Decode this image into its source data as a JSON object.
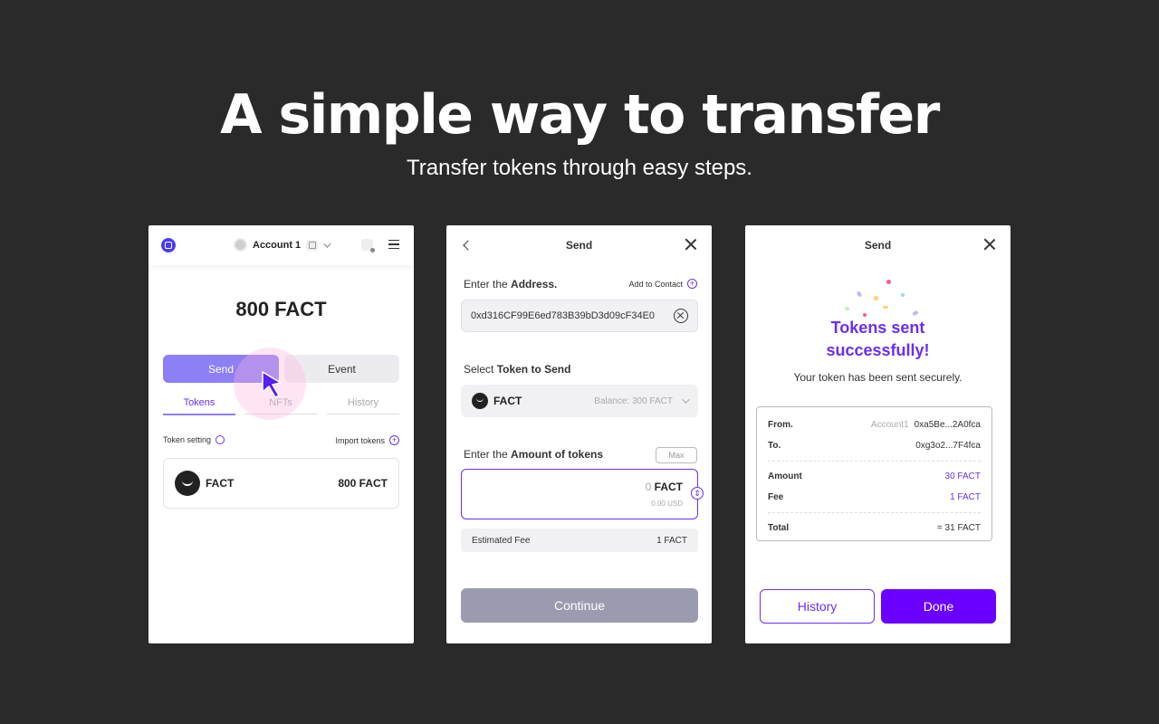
{
  "hero": {
    "title": "A simple way to transfer",
    "subtitle": "Transfer tokens through easy steps."
  },
  "wallet": {
    "account_name": "Account 1",
    "balance": "800 FACT",
    "send_label": "Send",
    "event_label": "Event",
    "tabs": [
      "Tokens",
      "NFTs",
      "History"
    ],
    "token_setting": "Token setting",
    "import_tokens": "Import tokens",
    "token_name": "FACT",
    "token_amount": "800 FACT"
  },
  "send_form": {
    "title": "Send",
    "address_label_pre": "Enter the ",
    "address_label_bold": "Address.",
    "add_contact": "Add to Contact",
    "address_value": "0xd316CF99E6ed783B39bD3d09cF34E0",
    "token_label_pre": "Select ",
    "token_label_bold": "Token to Send",
    "token_name": "FACT",
    "token_balance": "Balance:  300 FACT",
    "amount_label_pre": "Enter the ",
    "amount_label_bold": "Amount of tokens",
    "max_label": "Max",
    "amount_zero": "0",
    "amount_unit": "FACT",
    "amount_usd": "0.00 USD",
    "fee_label": "Estimated Fee",
    "fee_value": "1 FACT",
    "continue_label": "Continue"
  },
  "success": {
    "title": "Send",
    "heading_line1": "Tokens sent",
    "heading_line2": "successfully!",
    "subtitle": "Your token has been sent securely.",
    "from_label": "From.",
    "from_account": "Account1",
    "from_address": "0xa5Be...2A0fca",
    "to_label": "To.",
    "to_address": "0xg3o2...7F4fca",
    "amount_label": "Amount",
    "amount_value": "30 FACT",
    "fee_label": "Fee",
    "fee_value": "1 FACT",
    "total_label": "Total",
    "total_value": "= 31 FACT",
    "history_label": "History",
    "done_label": "Done"
  },
  "colors": {
    "accent": "#6a2ef5",
    "send_button": "#8d7ff5",
    "done_button": "#6a00ff",
    "background": "#2a2a2a"
  }
}
